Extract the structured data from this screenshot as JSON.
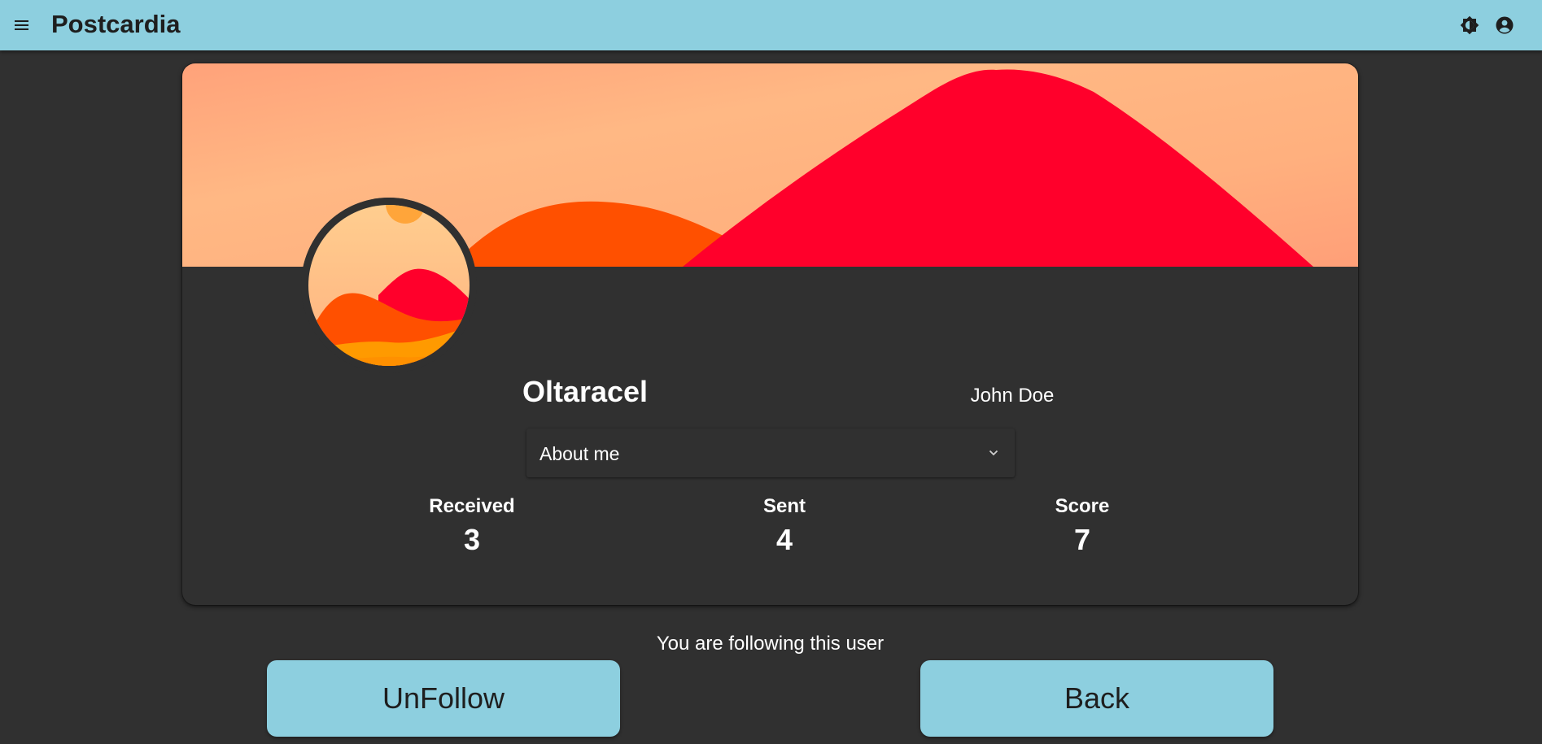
{
  "app": {
    "title": "Postcardia"
  },
  "header": {
    "menu_icon": "menu-icon",
    "theme_icon": "brightness-icon",
    "account_icon": "account-circle-icon"
  },
  "profile": {
    "username": "Oltaracel",
    "full_name": "John Doe",
    "about_label": "About me",
    "stats": [
      {
        "label": "Received",
        "value": "3"
      },
      {
        "label": "Sent",
        "value": "4"
      },
      {
        "label": "Score",
        "value": "7"
      }
    ]
  },
  "follow": {
    "status_text": "You are following this user",
    "unfollow_label": "UnFollow",
    "back_label": "Back"
  },
  "colors": {
    "header_bg": "#8dcfdf",
    "page_bg": "#303030",
    "accent_red": "#ff002b",
    "accent_orange": "#ff5000",
    "sky_peach": "#ffb280"
  }
}
